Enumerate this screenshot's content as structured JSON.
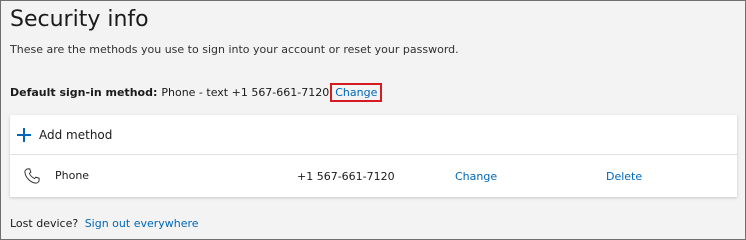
{
  "page": {
    "title": "Security info",
    "subtitle": "These are the methods you use to sign into your account or reset your password."
  },
  "default_method": {
    "label": "Default sign-in method:",
    "value": "Phone - text +1 567-661-7120",
    "change_link": "Change"
  },
  "methods_card": {
    "add_method_label": "Add method",
    "add_icon": "plus-icon",
    "rows": [
      {
        "icon": "phone-icon",
        "name": "Phone",
        "detail": "+1 567-661-7120",
        "change_label": "Change",
        "delete_label": "Delete"
      }
    ]
  },
  "footer": {
    "lost_device_label": "Lost device?",
    "sign_out_link": "Sign out everywhere"
  },
  "colors": {
    "link": "#0067b8",
    "highlight_border": "#d71921",
    "background": "#f3f3f3",
    "card": "#ffffff"
  }
}
